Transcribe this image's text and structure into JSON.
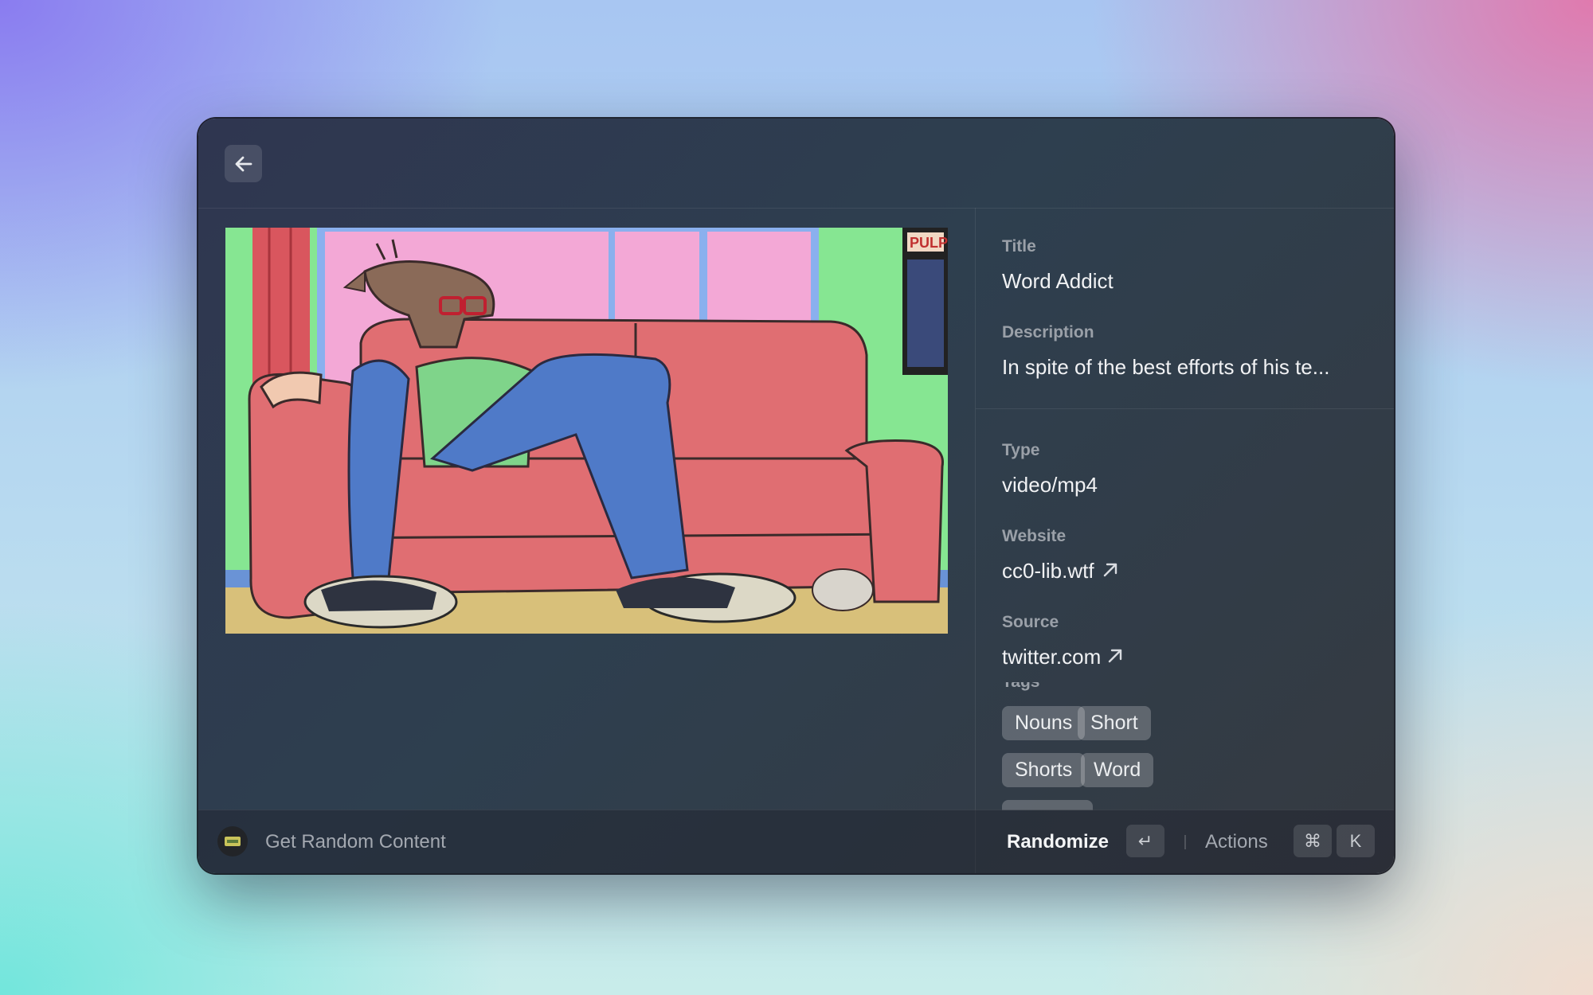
{
  "topbar": {
    "back_icon": "arrow-left-icon"
  },
  "preview": {
    "kind": "cartoon-illustration",
    "poster_text": "PULP"
  },
  "details": {
    "title_label": "Title",
    "title_value": "Word Addict",
    "description_label": "Description",
    "description_value": "In spite of the best efforts of his te...",
    "type_label": "Type",
    "type_value": "video/mp4",
    "website_label": "Website",
    "website_value": "cc0-lib.wtf",
    "source_label": "Source",
    "source_value": "twitter.com",
    "tags_label": "Tags",
    "tags": [
      "Nouns",
      "Short",
      "Shorts",
      "Word"
    ]
  },
  "footer": {
    "extension_icon": "ticket-icon",
    "command_title": "Get Random Content",
    "primary_action": "Randomize",
    "primary_key": "↵",
    "secondary_action": "Actions",
    "secondary_keys": [
      "⌘",
      "K"
    ]
  },
  "colors": {
    "window_bg": "#2e3a4c",
    "text_primary": "#f1f2f4",
    "text_secondary": "#9aa0a8",
    "tag_bg": "#5a6068"
  }
}
